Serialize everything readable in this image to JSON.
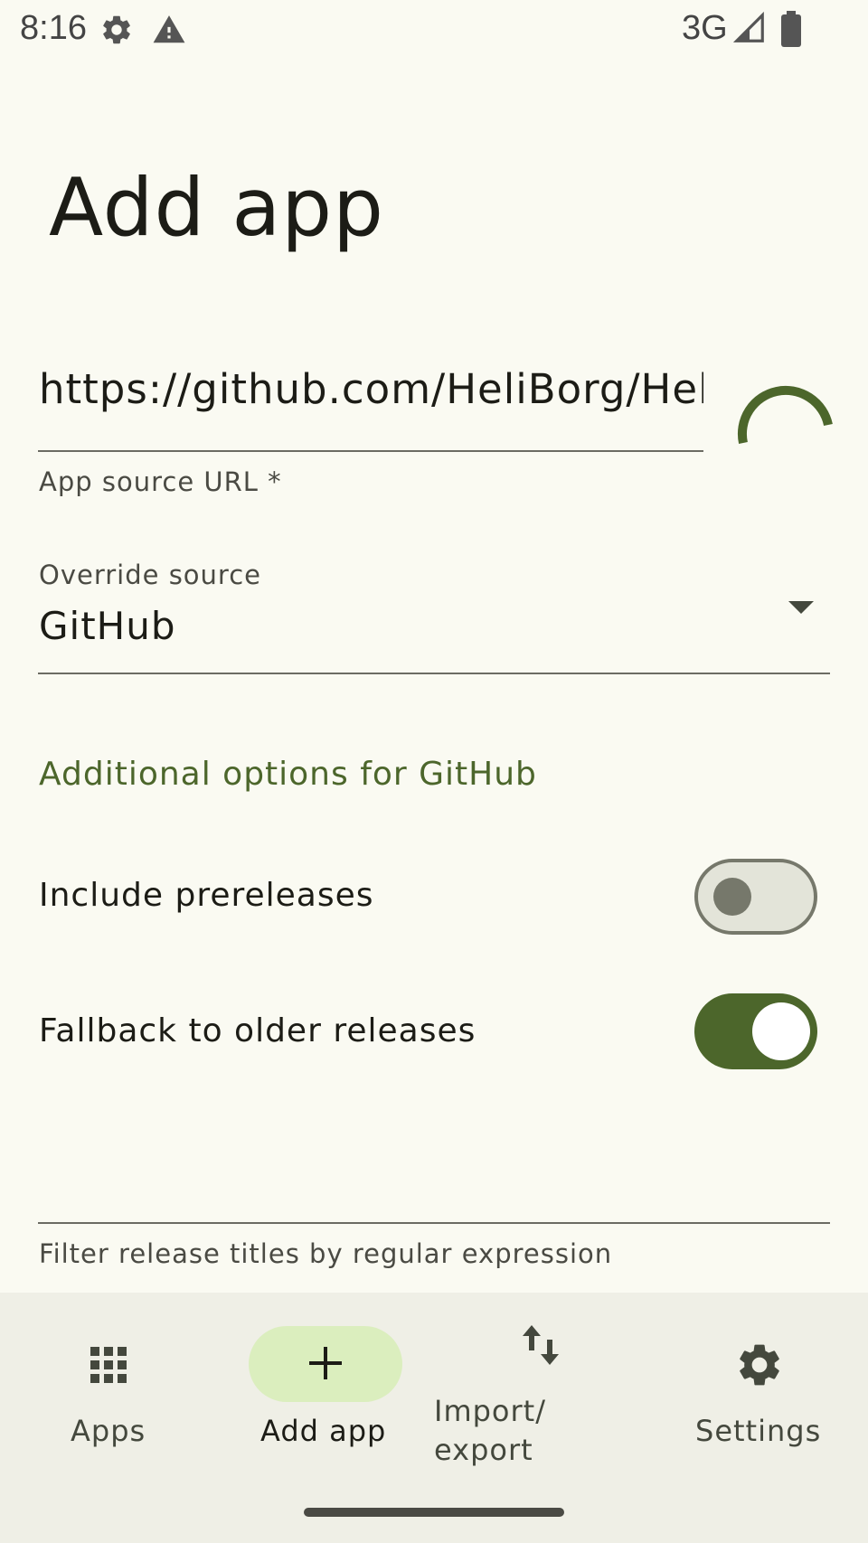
{
  "status_bar": {
    "time": "8:16",
    "network": "3G",
    "icons": [
      "gear-icon",
      "warning-icon",
      "signal-icon",
      "battery-icon"
    ]
  },
  "page": {
    "title": "Add app"
  },
  "url_field": {
    "value": "https://github.com/HeliBorg/Heli",
    "label": "App source URL *"
  },
  "override_source": {
    "label": "Override source",
    "value": "GitHub"
  },
  "additional_options": {
    "heading": "Additional options for GitHub",
    "options": [
      {
        "label": "Include prereleases",
        "enabled": false
      },
      {
        "label": "Fallback to older releases",
        "enabled": true
      }
    ],
    "filter_label": "Filter release titles by regular expression"
  },
  "bottom_nav": {
    "items": [
      {
        "label": "Apps",
        "icon": "grid-icon",
        "selected": false
      },
      {
        "label": "Add app",
        "icon": "plus-icon",
        "selected": true
      },
      {
        "label_line1": "Import/",
        "label_line2": "export",
        "icon": "import-export-icon",
        "selected": false
      },
      {
        "label": "Settings",
        "icon": "gear-icon",
        "selected": false
      }
    ]
  },
  "colors": {
    "background": "#fafaf2",
    "accent": "#4c662b",
    "nav_background": "#efefe6",
    "nav_selected_pill": "#dce7c8"
  }
}
